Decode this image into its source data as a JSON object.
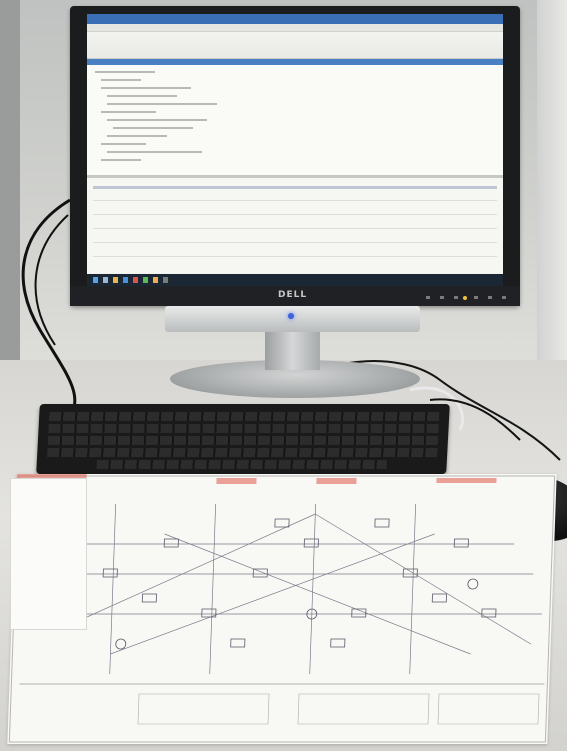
{
  "scene": {
    "description_visible_text": {
      "monitor_brand": "DELL"
    }
  },
  "colors": {
    "screen_accent": "#3b6fb5",
    "taskbar": "#1c2736",
    "power_indicator": "#3c62d8"
  },
  "icons": [
    "power-indicator-icon"
  ]
}
